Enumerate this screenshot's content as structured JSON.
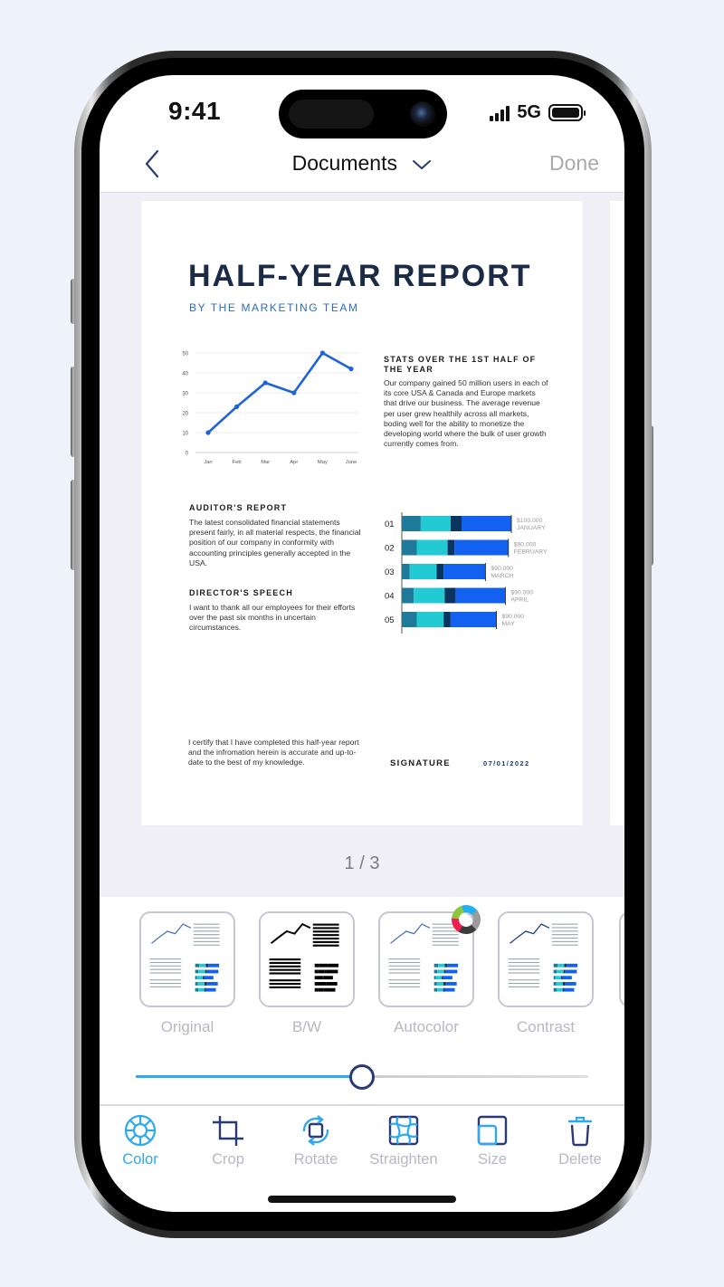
{
  "status_bar": {
    "time": "9:41",
    "network": "5G",
    "signal_bars": 4,
    "battery_level": 1.0
  },
  "nav": {
    "back_icon": "chevron-left-icon",
    "title": "Documents",
    "title_icon": "chevron-down-icon",
    "done_label": "Done"
  },
  "document": {
    "title": "HALF-YEAR REPORT",
    "subtitle": "BY THE MARKETING TEAM",
    "stats_heading": "STATS OVER THE 1ST HALF OF THE YEAR",
    "stats_body": "Our company gained 50 million users in each of its core USA & Canada and Europe markets that drive our business. The average revenue per user grew healthily across all markets, boding well for the ability to monetize the developing world where the bulk of user growth currently comes from.",
    "auditor_heading": "AUDITOR'S REPORT",
    "auditor_body": "The latest consolidated financial statements present fairly, in all material respects, the financial position of our company in conformity with accounting principles generally accepted in the USA.",
    "director_heading": "DIRECTOR'S SPEECH",
    "director_body": "I want to thank all our employees for their efforts over the past six months in uncertain circumstances.",
    "certify_text": "I certify that I have completed this half-year report and the infromation herein is accurate and up-to-date to the best of my knowledge.",
    "signature_label": "SIGNATURE",
    "signature_date": "07/01/2022"
  },
  "chart_data": [
    {
      "type": "line",
      "title": "",
      "xlabel": "",
      "ylabel": "",
      "categories": [
        "Jan",
        "Feb",
        "Mar",
        "Apr",
        "May",
        "June"
      ],
      "values": [
        10,
        23,
        35,
        30,
        50,
        42
      ],
      "y_ticks": [
        0,
        10,
        20,
        30,
        40,
        50
      ],
      "ylim": [
        0,
        50
      ],
      "grid": true,
      "color": "#1f62d9"
    },
    {
      "type": "bar",
      "orientation": "horizontal",
      "stacked": true,
      "categories": [
        "01",
        "02",
        "03",
        "04",
        "05"
      ],
      "value_labels": [
        "$100.000",
        "$90.000",
        "$90.000",
        "$90.000",
        "$90.000"
      ],
      "month_labels": [
        "JANUARY",
        "FEBRUARY",
        "MARCH",
        "APRIL",
        "MAY"
      ],
      "series": [
        {
          "name": "segment-1",
          "color": "#1f7a9a",
          "values": [
            19,
            15,
            8,
            12,
            15
          ]
        },
        {
          "name": "segment-2",
          "color": "#22cbd4",
          "values": [
            30,
            31,
            27,
            31,
            27
          ]
        },
        {
          "name": "segment-3",
          "color": "#0b3561",
          "values": [
            11,
            7,
            7,
            11,
            7
          ]
        },
        {
          "name": "segment-4",
          "color": "#1261f0",
          "values": [
            50,
            54,
            42,
            50,
            46
          ]
        }
      ]
    }
  ],
  "pager": {
    "current": 1,
    "total": 3,
    "label": "1 / 3"
  },
  "filters": [
    {
      "label": "Original",
      "active": true
    },
    {
      "label": "B/W",
      "active": false
    },
    {
      "label": "Autocolor",
      "active": false
    },
    {
      "label": "Contrast",
      "active": false
    }
  ],
  "intensity_slider": {
    "value": 0.5
  },
  "toolbar": [
    {
      "label": "Color",
      "icon": "color-wheel-icon",
      "active": true
    },
    {
      "label": "Crop",
      "icon": "crop-icon",
      "active": false
    },
    {
      "label": "Rotate",
      "icon": "rotate-icon",
      "active": false
    },
    {
      "label": "Straighten",
      "icon": "straighten-icon",
      "active": false
    },
    {
      "label": "Size",
      "icon": "size-icon",
      "active": false
    },
    {
      "label": "Delete",
      "icon": "trash-icon",
      "active": false
    }
  ],
  "colors": {
    "accent": "#2ea8ee",
    "navy": "#2c3a74",
    "title_navy": "#1b2a45",
    "subtitle_blue": "#2d6db5",
    "inactive_label": "#b6b8c6",
    "preview_bg": "#efeff5"
  }
}
